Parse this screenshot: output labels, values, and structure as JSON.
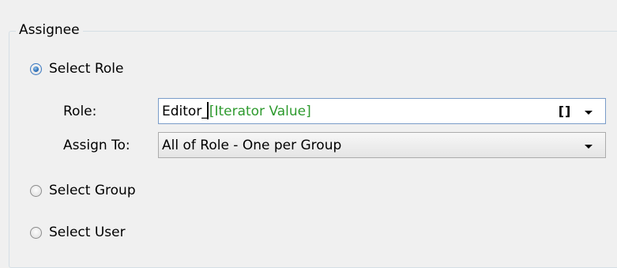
{
  "assignee": {
    "group_title": "Assignee",
    "options": {
      "select_role": {
        "label": "Select Role",
        "checked": true
      },
      "select_group": {
        "label": "Select Group",
        "checked": false
      },
      "select_user": {
        "label": "Select User",
        "checked": false
      }
    },
    "role": {
      "label": "Role:",
      "value_text": "Editor_",
      "iterator_token": "[Iterator Value]",
      "bracket_button": "[]",
      "token_color": "#2e9a2e"
    },
    "assign_to": {
      "label": "Assign To:",
      "selected": "All of Role - One per Group"
    }
  },
  "icons": {
    "radio_checked": "radio-selected-icon",
    "radio_unchecked": "radio-unselected-icon",
    "dropdown": "chevron-down-icon"
  },
  "colors": {
    "background": "#f0f0f0",
    "groupbox_border": "#d5dfe5",
    "radio_accent": "#2a6db5",
    "input_border": "#7a9cc9"
  }
}
